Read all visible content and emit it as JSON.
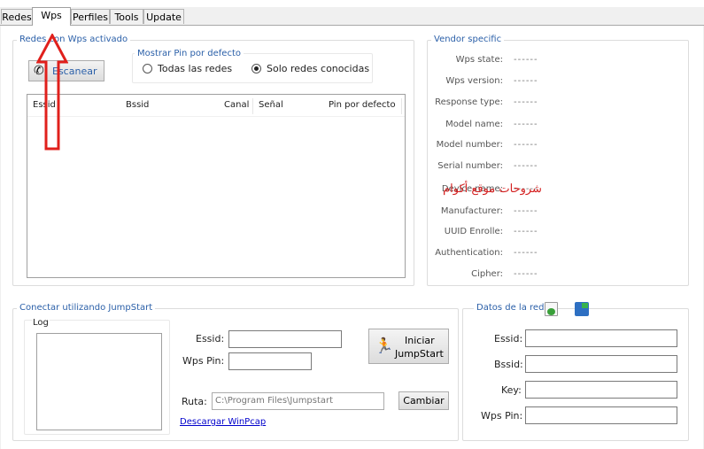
{
  "tabs": [
    "Redes",
    "Wps",
    "Perfiles",
    "Tools",
    "Update"
  ],
  "networks_group": {
    "title": "Redes con Wps activado",
    "scan_button": "Escanear",
    "pin_options_title": "Mostrar Pin por defecto",
    "radio_all": "Todas las redes",
    "radio_known": "Solo redes conocidas",
    "selected_radio": "Solo redes conocidas",
    "columns": [
      "Essid",
      "Bssid",
      "Canal",
      "Señal",
      "Pin por defecto"
    ]
  },
  "vendor_group": {
    "title": "Vendor specific",
    "fields": [
      {
        "label": "Wps state:",
        "value": "------"
      },
      {
        "label": "Wps version:",
        "value": "------"
      },
      {
        "label": "Response type:",
        "value": "------"
      },
      {
        "label": "Model name:",
        "value": "------"
      },
      {
        "label": "Model number:",
        "value": "------"
      },
      {
        "label": "Serial number:",
        "value": "------"
      },
      {
        "label": "Device name:",
        "value": "------"
      },
      {
        "label": "Manufacturer:",
        "value": "------"
      },
      {
        "label": "UUID Enrolle:",
        "value": "------"
      },
      {
        "label": "Authentication:",
        "value": "------"
      },
      {
        "label": "Cipher:",
        "value": "------"
      }
    ],
    "watermark": "شروحات موقع أكوام"
  },
  "jumpstart_group": {
    "title": "Conectar utilizando JumpStart",
    "log_label": "Log",
    "essid_label": "Essid:",
    "essid_value": "",
    "wpspin_label": "Wps Pin:",
    "wpspin_value": "",
    "start_button_line1": "Iniciar",
    "start_button_line2": "JumpStart",
    "path_label": "Ruta:",
    "path_value": "C:\\Program Files\\Jumpstart",
    "change_button": "Cambiar",
    "download_link": "Descargar WinPcap"
  },
  "netdata_group": {
    "title": "Datos de la red",
    "essid_label": "Essid:",
    "bssid_label": "Bssid:",
    "key_label": "Key:",
    "wpspin_label": "Wps Pin:",
    "essid_value": "",
    "bssid_value": "",
    "key_value": "",
    "wpspin_value": ""
  },
  "colors": {
    "group_title": "#2a5fa8",
    "annotation_arrow": "#e0201c",
    "watermark": "#d42020"
  }
}
